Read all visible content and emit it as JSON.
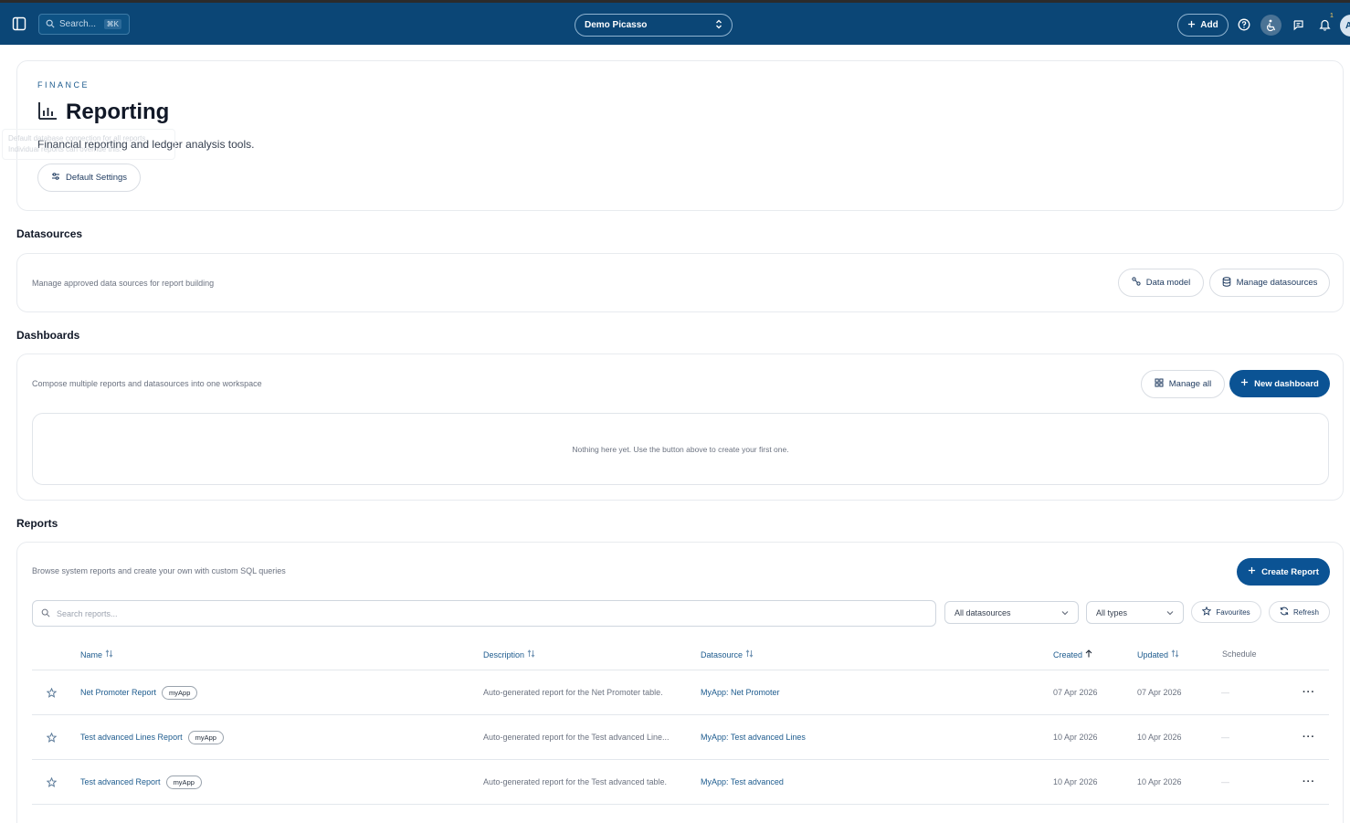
{
  "topbar": {
    "search_label": "Search...",
    "search_shortcut": "⌘K",
    "workspace": "Demo Picasso",
    "add_label": "Add",
    "notification_count": "1",
    "avatar_initial": "A"
  },
  "hero": {
    "eyebrow": "FINANCE",
    "title": "Reporting",
    "subtitle": "Financial reporting and ledger analysis tools.",
    "tooltip_line1": "Default database connection for all reports.",
    "tooltip_line2": "Individual reports can override this.",
    "default_settings_label": "Default Settings"
  },
  "datasources": {
    "title": "Datasources",
    "description": "Manage approved data sources for report building",
    "data_model_label": "Data model",
    "manage_label": "Manage datasources"
  },
  "dashboards": {
    "title": "Dashboards",
    "description": "Compose multiple reports and datasources into one workspace",
    "manage_all_label": "Manage all",
    "new_label": "New dashboard",
    "empty_text": "Nothing here yet. Use the button above to create your first one."
  },
  "reports": {
    "title": "Reports",
    "description": "Browse system reports and create your own with custom SQL queries",
    "create_label": "Create Report",
    "search_placeholder": "Search reports...",
    "datasource_filter": "All datasources",
    "type_filter": "All types",
    "favourites_label": "Favourites",
    "refresh_label": "Refresh",
    "columns": {
      "name": "Name",
      "description": "Description",
      "datasource": "Datasource",
      "created": "Created",
      "updated": "Updated",
      "schedule": "Schedule"
    },
    "rows": [
      {
        "name": "Net Promoter Report",
        "tag": "myApp",
        "description": "Auto-generated report for the Net Promoter table.",
        "datasource": "MyApp: Net Promoter",
        "created": "07 Apr 2026",
        "updated": "07 Apr 2026",
        "schedule": "—"
      },
      {
        "name": "Test advanced Lines Report",
        "tag": "myApp",
        "description": "Auto-generated report for the Test advanced Line...",
        "datasource": "MyApp: Test advanced Lines",
        "created": "10 Apr 2026",
        "updated": "10 Apr 2026",
        "schedule": "—"
      },
      {
        "name": "Test advanced Report",
        "tag": "myApp",
        "description": "Auto-generated report for the Test advanced table.",
        "datasource": "MyApp: Test advanced",
        "created": "10 Apr 2026",
        "updated": "10 Apr 2026",
        "schedule": "—"
      }
    ]
  }
}
